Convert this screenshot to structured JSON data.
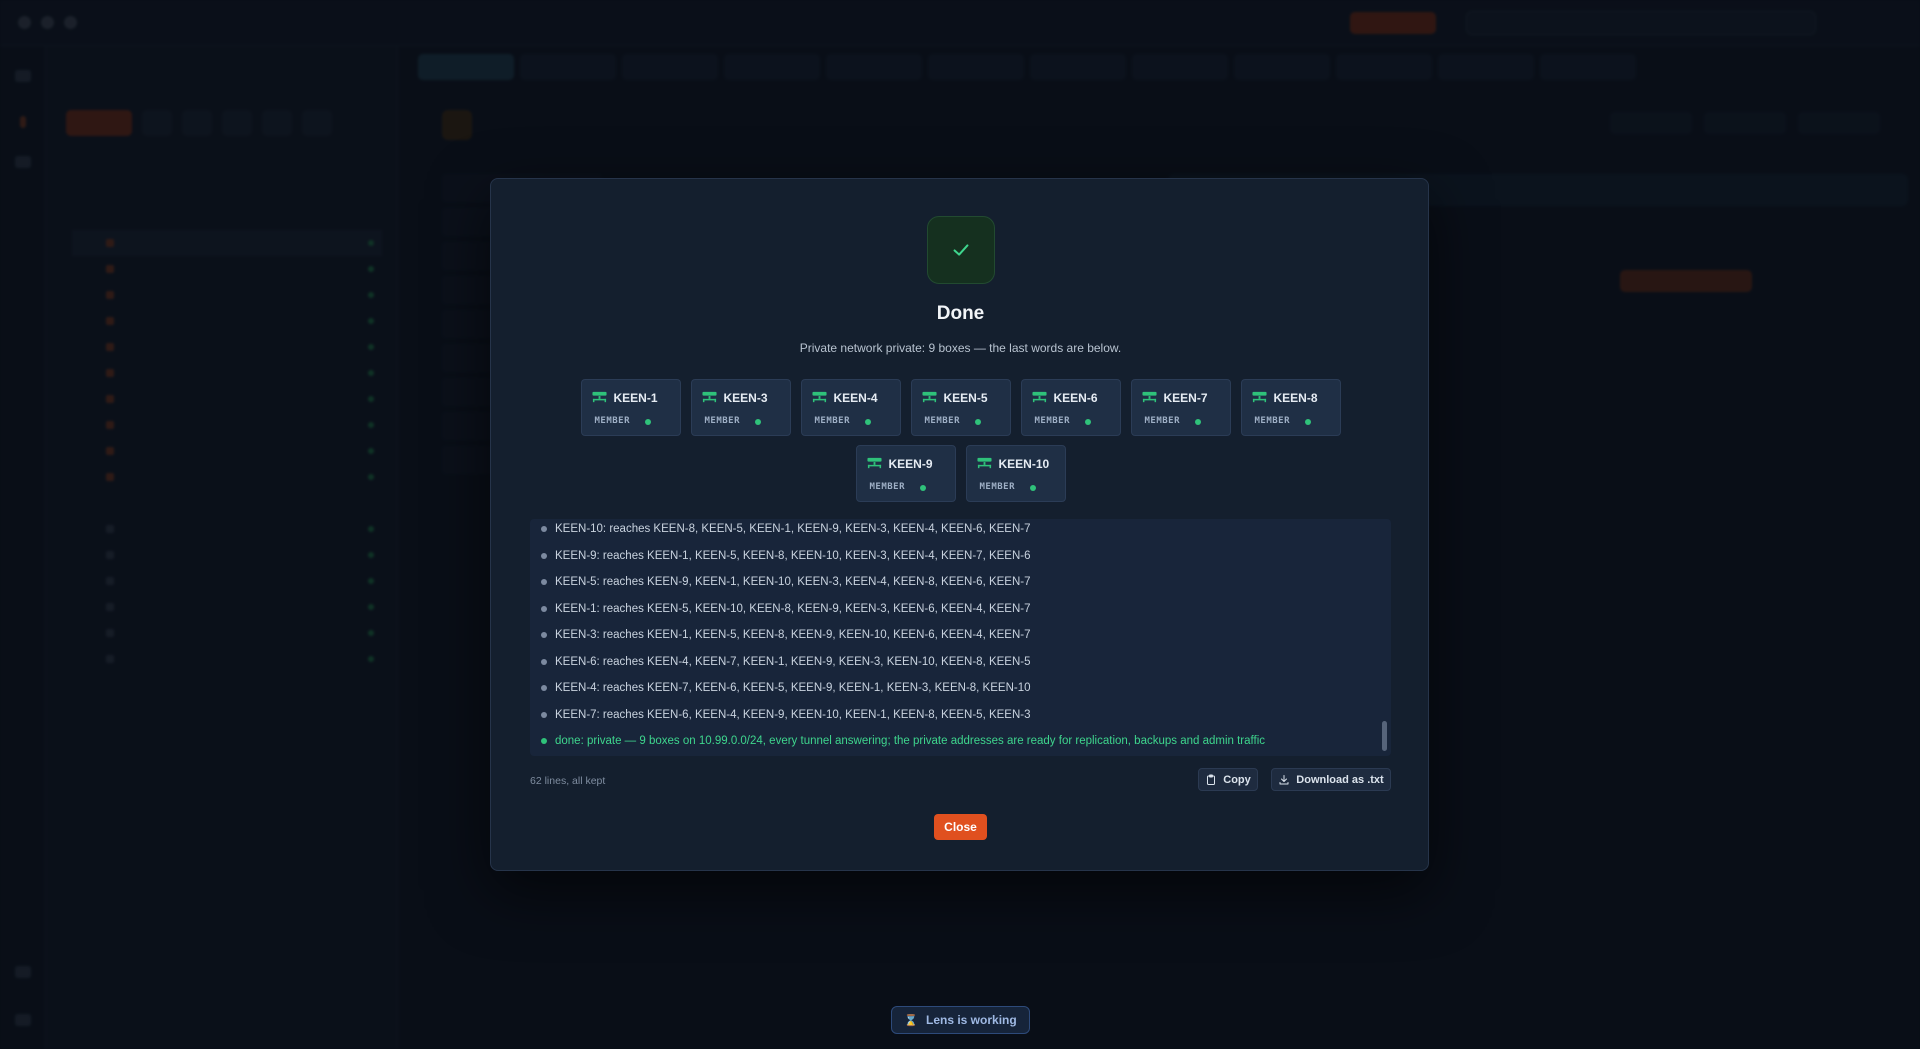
{
  "modal": {
    "heading": "Done",
    "description": "Private network private: 9 boxes — the last words are below.",
    "nodes_row1": [
      {
        "name": "KEEN-1",
        "role": "MEMBER"
      },
      {
        "name": "KEEN-3",
        "role": "MEMBER"
      },
      {
        "name": "KEEN-4",
        "role": "MEMBER"
      },
      {
        "name": "KEEN-5",
        "role": "MEMBER"
      },
      {
        "name": "KEEN-6",
        "role": "MEMBER"
      },
      {
        "name": "KEEN-7",
        "role": "MEMBER"
      },
      {
        "name": "KEEN-8",
        "role": "MEMBER"
      }
    ],
    "nodes_row2": [
      {
        "name": "KEEN-9",
        "role": "MEMBER"
      },
      {
        "name": "KEEN-10",
        "role": "MEMBER"
      }
    ],
    "log": [
      "KEEN-10: reaches KEEN-8, KEEN-5, KEEN-1, KEEN-9, KEEN-3, KEEN-4, KEEN-6, KEEN-7",
      "KEEN-9: reaches KEEN-1, KEEN-5, KEEN-8, KEEN-10, KEEN-3, KEEN-4, KEEN-7, KEEN-6",
      "KEEN-5: reaches KEEN-9, KEEN-1, KEEN-10, KEEN-3, KEEN-4, KEEN-8, KEEN-6, KEEN-7",
      "KEEN-1: reaches KEEN-5, KEEN-10, KEEN-8, KEEN-9, KEEN-3, KEEN-6, KEEN-4, KEEN-7",
      "KEEN-3: reaches KEEN-1, KEEN-5, KEEN-8, KEEN-9, KEEN-10, KEEN-6, KEEN-4, KEEN-7",
      "KEEN-6: reaches KEEN-4, KEEN-7, KEEN-1, KEEN-9, KEEN-3, KEEN-10, KEEN-8, KEEN-5",
      "KEEN-4: reaches KEEN-7, KEEN-6, KEEN-5, KEEN-9, KEEN-1, KEEN-3, KEEN-8, KEEN-10",
      "KEEN-7: reaches KEEN-6, KEEN-4, KEEN-9, KEEN-10, KEEN-1, KEEN-8, KEEN-5, KEEN-3"
    ],
    "done_line": "done: private — 9 boxes on 10.99.0.0/24, every tunnel answering; the private addresses are ready for replication, backups and admin traffic",
    "log_count": "62 lines, all kept",
    "copy_label": "Copy",
    "download_label": "Download as .txt",
    "close_label": "Close"
  },
  "status_pill": {
    "label": "Lens is working"
  },
  "colors": {
    "accent": "#e0501f",
    "success": "#2fc27a",
    "modal_bg": "#141f2e"
  },
  "icons": {
    "check": "check-icon",
    "server": "server-icon",
    "copy": "clipboard-icon",
    "download": "download-icon",
    "hourglass": "hourglass-icon"
  }
}
